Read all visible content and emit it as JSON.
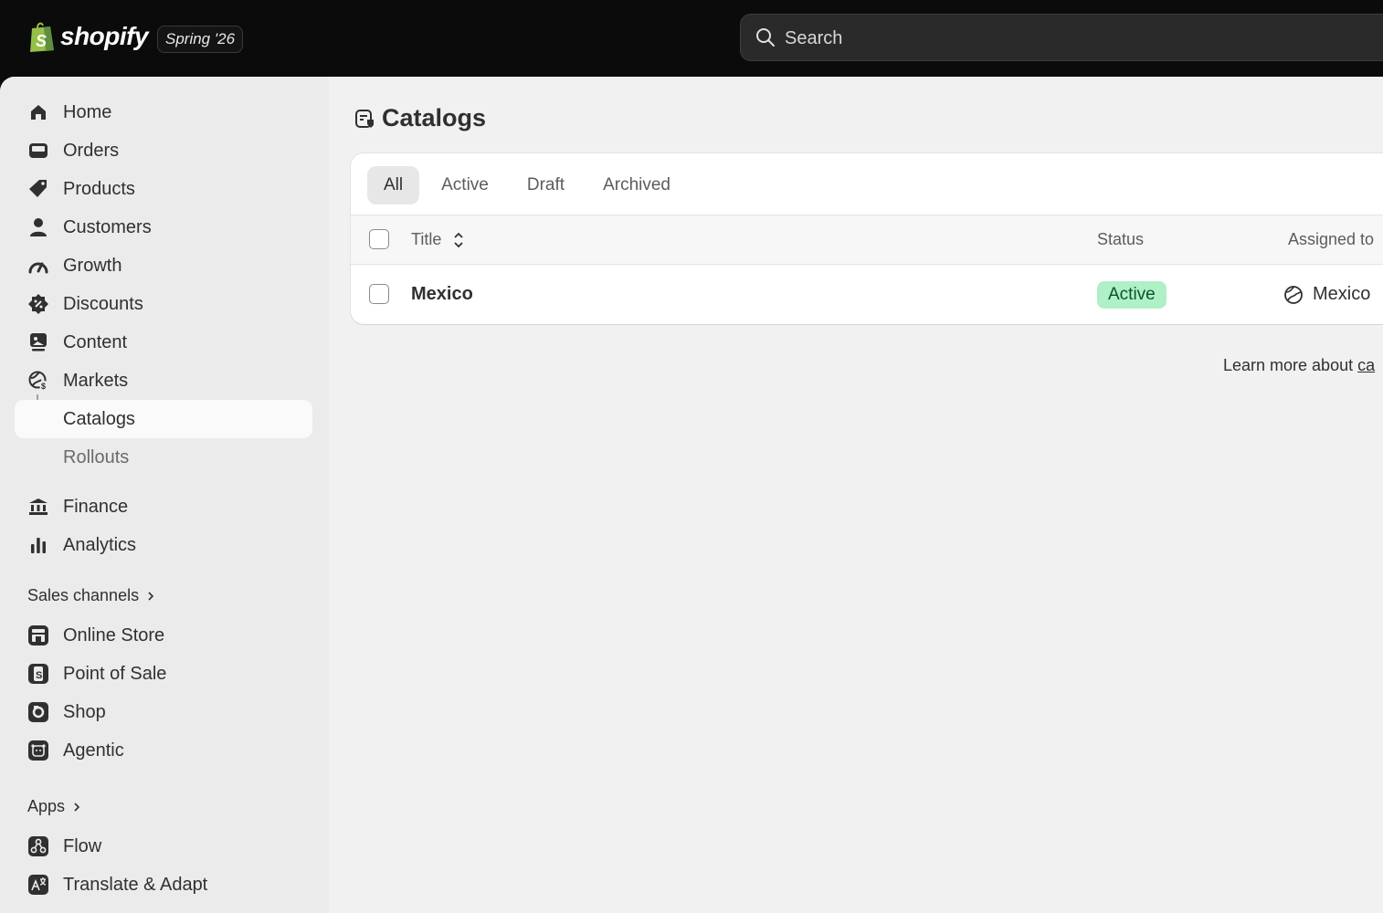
{
  "topbar": {
    "brand": "shopify",
    "edition": "Spring '26",
    "search_placeholder": "Search"
  },
  "sidebar": {
    "items": [
      {
        "label": "Home",
        "icon": "home-icon"
      },
      {
        "label": "Orders",
        "icon": "inbox-icon"
      },
      {
        "label": "Products",
        "icon": "tag-icon"
      },
      {
        "label": "Customers",
        "icon": "person-icon"
      },
      {
        "label": "Growth",
        "icon": "gauge-icon"
      },
      {
        "label": "Discounts",
        "icon": "discount-icon"
      },
      {
        "label": "Content",
        "icon": "image-icon"
      },
      {
        "label": "Markets",
        "icon": "globe-icon"
      },
      {
        "label": "Catalogs",
        "icon": "tree-arrow-icon",
        "active": true
      },
      {
        "label": "Rollouts",
        "icon": ""
      },
      {
        "label": "Finance",
        "icon": "bank-icon"
      },
      {
        "label": "Analytics",
        "icon": "bar-chart-icon"
      }
    ],
    "sales_channels_label": "Sales channels",
    "sales_channels": [
      {
        "label": "Online Store",
        "icon": "storefront-icon"
      },
      {
        "label": "Point of Sale",
        "icon": "pos-icon"
      },
      {
        "label": "Shop",
        "icon": "shop-icon"
      },
      {
        "label": "Agentic",
        "icon": "agentic-icon"
      }
    ],
    "apps_label": "Apps",
    "apps": [
      {
        "label": "Flow",
        "icon": "flow-icon"
      },
      {
        "label": "Translate & Adapt",
        "icon": "translate-icon"
      }
    ]
  },
  "page": {
    "title": "Catalogs",
    "tabs": [
      "All",
      "Active",
      "Draft",
      "Archived"
    ],
    "selected_tab": "All",
    "columns": {
      "title": "Title",
      "status": "Status",
      "assigned": "Assigned to"
    },
    "rows": [
      {
        "title": "Mexico",
        "status": "Active",
        "assigned_to": "Mexico"
      }
    ],
    "learn_more_prefix": "Learn more about ",
    "learn_more_link": "ca"
  },
  "colors": {
    "topbar_bg": "#0b0b0b",
    "sidebar_bg": "#ebebeb",
    "content_bg": "#f1f1f1",
    "badge_active_bg": "#aff0c6",
    "badge_active_text": "#0c5132"
  }
}
